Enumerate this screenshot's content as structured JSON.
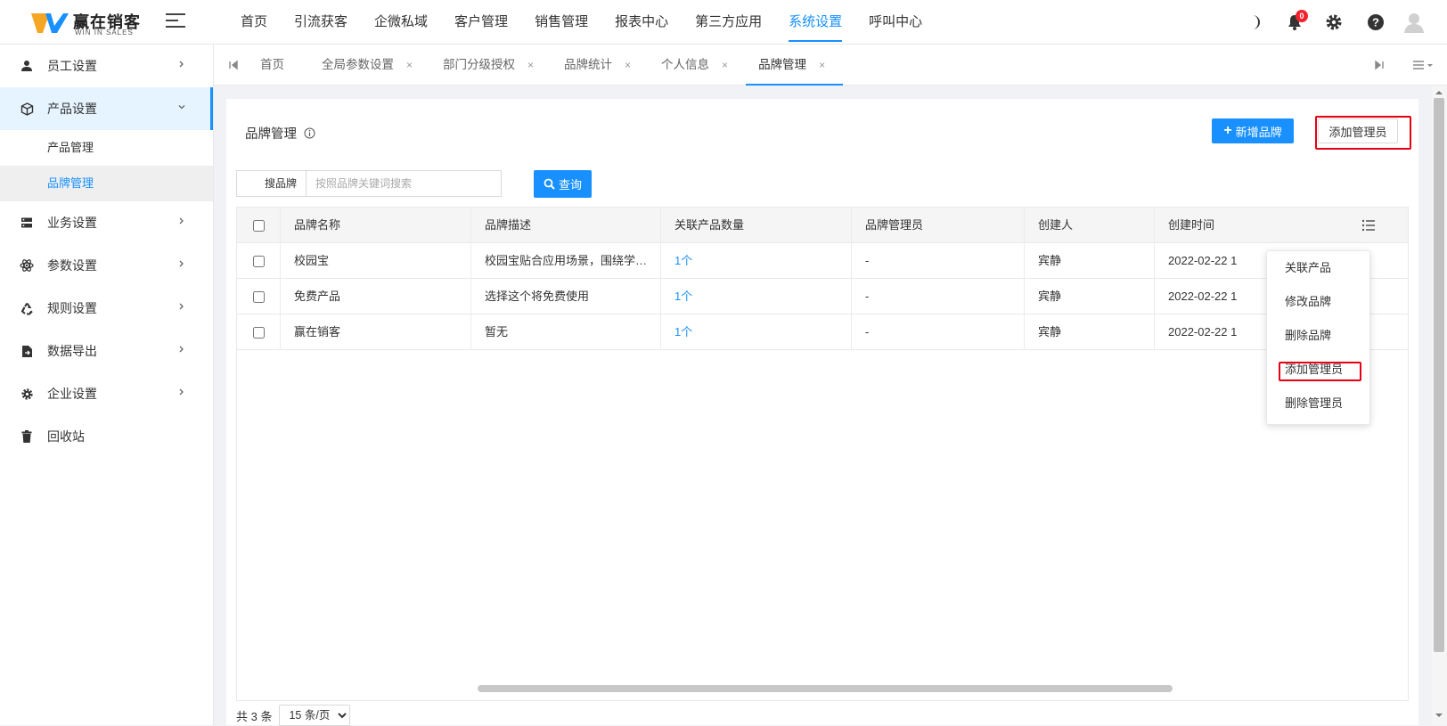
{
  "brand": {
    "name": "赢在销客",
    "sub": "WIN IN SALES",
    "accent": "#1890ff",
    "logo_colors": [
      "#f5a623",
      "#1890ff"
    ]
  },
  "topnav": {
    "items": [
      {
        "label": "首页"
      },
      {
        "label": "引流获客"
      },
      {
        "label": "企微私域"
      },
      {
        "label": "客户管理"
      },
      {
        "label": "销售管理"
      },
      {
        "label": "报表中心"
      },
      {
        "label": "第三方应用"
      },
      {
        "label": "系统设置"
      },
      {
        "label": "呼叫中心"
      }
    ],
    "active_index": 7,
    "notification_count": "0",
    "icons": [
      "moon-icon",
      "bell-icon",
      "gear-icon",
      "help-icon",
      "user-avatar-icon"
    ]
  },
  "sidebar": {
    "items": [
      {
        "label": "员工设置",
        "icon": "user-icon"
      },
      {
        "label": "产品设置",
        "icon": "cube-icon",
        "open": true,
        "children": [
          {
            "label": "产品管理"
          },
          {
            "label": "品牌管理",
            "active": true
          }
        ]
      },
      {
        "label": "业务设置",
        "icon": "server-icon"
      },
      {
        "label": "参数设置",
        "icon": "atom-icon"
      },
      {
        "label": "规则设置",
        "icon": "recycle-icon"
      },
      {
        "label": "数据导出",
        "icon": "file-export-icon"
      },
      {
        "label": "企业设置",
        "icon": "gear-icon"
      },
      {
        "label": "回收站",
        "icon": "trash-icon"
      }
    ]
  },
  "tabs": {
    "items": [
      {
        "label": "首页",
        "closable": false
      },
      {
        "label": "全局参数设置",
        "closable": true
      },
      {
        "label": "部门分级授权",
        "closable": true
      },
      {
        "label": "品牌统计",
        "closable": true
      },
      {
        "label": "个人信息",
        "closable": true
      },
      {
        "label": "品牌管理",
        "closable": true,
        "active": true
      }
    ],
    "close_glyph": "×"
  },
  "page": {
    "title": "品牌管理",
    "add_brand_label": "新增品牌",
    "add_brand_plus": "+",
    "add_admin_label": "添加管理员",
    "highlight_color": "#e60012"
  },
  "search": {
    "label": "搜品牌",
    "placeholder": "按照品牌关键词搜索",
    "value": "",
    "query_label": "查询"
  },
  "table": {
    "columns": [
      "品牌名称",
      "品牌描述",
      "关联产品数量",
      "品牌管理员",
      "创建人",
      "创建时间"
    ],
    "rows": [
      {
        "name": "校园宝",
        "desc": "校园宝贴合应用场景，围绕学校…",
        "count": "1个",
        "admin": "-",
        "creator": "宾静",
        "created": "2022-02-22 1"
      },
      {
        "name": "免费产品",
        "desc": "选择这个将免费使用",
        "count": "1个",
        "admin": "-",
        "creator": "宾静",
        "created": "2022-02-22 1"
      },
      {
        "name": "赢在销客",
        "desc": "暂无",
        "count": "1个",
        "admin": "-",
        "creator": "宾静",
        "created": "2022-02-22 1"
      }
    ]
  },
  "pager": {
    "total": "共 3 条",
    "page_size": "15 条/页"
  },
  "dropdown": {
    "items": [
      "关联产品",
      "修改品牌",
      "删除品牌",
      "添加管理员",
      "删除管理员"
    ],
    "highlighted_index": 3
  }
}
